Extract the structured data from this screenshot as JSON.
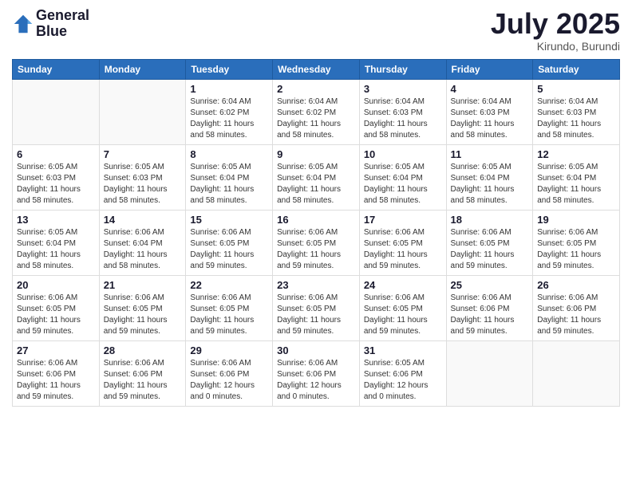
{
  "logo": {
    "line1": "General",
    "line2": "Blue"
  },
  "title": "July 2025",
  "location": "Kirundo, Burundi",
  "weekdays": [
    "Sunday",
    "Monday",
    "Tuesday",
    "Wednesday",
    "Thursday",
    "Friday",
    "Saturday"
  ],
  "weeks": [
    [
      {
        "day": "",
        "empty": true
      },
      {
        "day": "",
        "empty": true
      },
      {
        "day": "1",
        "sunrise": "Sunrise: 6:04 AM",
        "sunset": "Sunset: 6:02 PM",
        "daylight": "Daylight: 11 hours and 58 minutes."
      },
      {
        "day": "2",
        "sunrise": "Sunrise: 6:04 AM",
        "sunset": "Sunset: 6:02 PM",
        "daylight": "Daylight: 11 hours and 58 minutes."
      },
      {
        "day": "3",
        "sunrise": "Sunrise: 6:04 AM",
        "sunset": "Sunset: 6:03 PM",
        "daylight": "Daylight: 11 hours and 58 minutes."
      },
      {
        "day": "4",
        "sunrise": "Sunrise: 6:04 AM",
        "sunset": "Sunset: 6:03 PM",
        "daylight": "Daylight: 11 hours and 58 minutes."
      },
      {
        "day": "5",
        "sunrise": "Sunrise: 6:04 AM",
        "sunset": "Sunset: 6:03 PM",
        "daylight": "Daylight: 11 hours and 58 minutes."
      }
    ],
    [
      {
        "day": "6",
        "sunrise": "Sunrise: 6:05 AM",
        "sunset": "Sunset: 6:03 PM",
        "daylight": "Daylight: 11 hours and 58 minutes."
      },
      {
        "day": "7",
        "sunrise": "Sunrise: 6:05 AM",
        "sunset": "Sunset: 6:03 PM",
        "daylight": "Daylight: 11 hours and 58 minutes."
      },
      {
        "day": "8",
        "sunrise": "Sunrise: 6:05 AM",
        "sunset": "Sunset: 6:04 PM",
        "daylight": "Daylight: 11 hours and 58 minutes."
      },
      {
        "day": "9",
        "sunrise": "Sunrise: 6:05 AM",
        "sunset": "Sunset: 6:04 PM",
        "daylight": "Daylight: 11 hours and 58 minutes."
      },
      {
        "day": "10",
        "sunrise": "Sunrise: 6:05 AM",
        "sunset": "Sunset: 6:04 PM",
        "daylight": "Daylight: 11 hours and 58 minutes."
      },
      {
        "day": "11",
        "sunrise": "Sunrise: 6:05 AM",
        "sunset": "Sunset: 6:04 PM",
        "daylight": "Daylight: 11 hours and 58 minutes."
      },
      {
        "day": "12",
        "sunrise": "Sunrise: 6:05 AM",
        "sunset": "Sunset: 6:04 PM",
        "daylight": "Daylight: 11 hours and 58 minutes."
      }
    ],
    [
      {
        "day": "13",
        "sunrise": "Sunrise: 6:05 AM",
        "sunset": "Sunset: 6:04 PM",
        "daylight": "Daylight: 11 hours and 58 minutes."
      },
      {
        "day": "14",
        "sunrise": "Sunrise: 6:06 AM",
        "sunset": "Sunset: 6:04 PM",
        "daylight": "Daylight: 11 hours and 58 minutes."
      },
      {
        "day": "15",
        "sunrise": "Sunrise: 6:06 AM",
        "sunset": "Sunset: 6:05 PM",
        "daylight": "Daylight: 11 hours and 59 minutes."
      },
      {
        "day": "16",
        "sunrise": "Sunrise: 6:06 AM",
        "sunset": "Sunset: 6:05 PM",
        "daylight": "Daylight: 11 hours and 59 minutes."
      },
      {
        "day": "17",
        "sunrise": "Sunrise: 6:06 AM",
        "sunset": "Sunset: 6:05 PM",
        "daylight": "Daylight: 11 hours and 59 minutes."
      },
      {
        "day": "18",
        "sunrise": "Sunrise: 6:06 AM",
        "sunset": "Sunset: 6:05 PM",
        "daylight": "Daylight: 11 hours and 59 minutes."
      },
      {
        "day": "19",
        "sunrise": "Sunrise: 6:06 AM",
        "sunset": "Sunset: 6:05 PM",
        "daylight": "Daylight: 11 hours and 59 minutes."
      }
    ],
    [
      {
        "day": "20",
        "sunrise": "Sunrise: 6:06 AM",
        "sunset": "Sunset: 6:05 PM",
        "daylight": "Daylight: 11 hours and 59 minutes."
      },
      {
        "day": "21",
        "sunrise": "Sunrise: 6:06 AM",
        "sunset": "Sunset: 6:05 PM",
        "daylight": "Daylight: 11 hours and 59 minutes."
      },
      {
        "day": "22",
        "sunrise": "Sunrise: 6:06 AM",
        "sunset": "Sunset: 6:05 PM",
        "daylight": "Daylight: 11 hours and 59 minutes."
      },
      {
        "day": "23",
        "sunrise": "Sunrise: 6:06 AM",
        "sunset": "Sunset: 6:05 PM",
        "daylight": "Daylight: 11 hours and 59 minutes."
      },
      {
        "day": "24",
        "sunrise": "Sunrise: 6:06 AM",
        "sunset": "Sunset: 6:05 PM",
        "daylight": "Daylight: 11 hours and 59 minutes."
      },
      {
        "day": "25",
        "sunrise": "Sunrise: 6:06 AM",
        "sunset": "Sunset: 6:06 PM",
        "daylight": "Daylight: 11 hours and 59 minutes."
      },
      {
        "day": "26",
        "sunrise": "Sunrise: 6:06 AM",
        "sunset": "Sunset: 6:06 PM",
        "daylight": "Daylight: 11 hours and 59 minutes."
      }
    ],
    [
      {
        "day": "27",
        "sunrise": "Sunrise: 6:06 AM",
        "sunset": "Sunset: 6:06 PM",
        "daylight": "Daylight: 11 hours and 59 minutes."
      },
      {
        "day": "28",
        "sunrise": "Sunrise: 6:06 AM",
        "sunset": "Sunset: 6:06 PM",
        "daylight": "Daylight: 11 hours and 59 minutes."
      },
      {
        "day": "29",
        "sunrise": "Sunrise: 6:06 AM",
        "sunset": "Sunset: 6:06 PM",
        "daylight": "Daylight: 12 hours and 0 minutes."
      },
      {
        "day": "30",
        "sunrise": "Sunrise: 6:06 AM",
        "sunset": "Sunset: 6:06 PM",
        "daylight": "Daylight: 12 hours and 0 minutes."
      },
      {
        "day": "31",
        "sunrise": "Sunrise: 6:05 AM",
        "sunset": "Sunset: 6:06 PM",
        "daylight": "Daylight: 12 hours and 0 minutes."
      },
      {
        "day": "",
        "empty": true
      },
      {
        "day": "",
        "empty": true
      }
    ]
  ]
}
